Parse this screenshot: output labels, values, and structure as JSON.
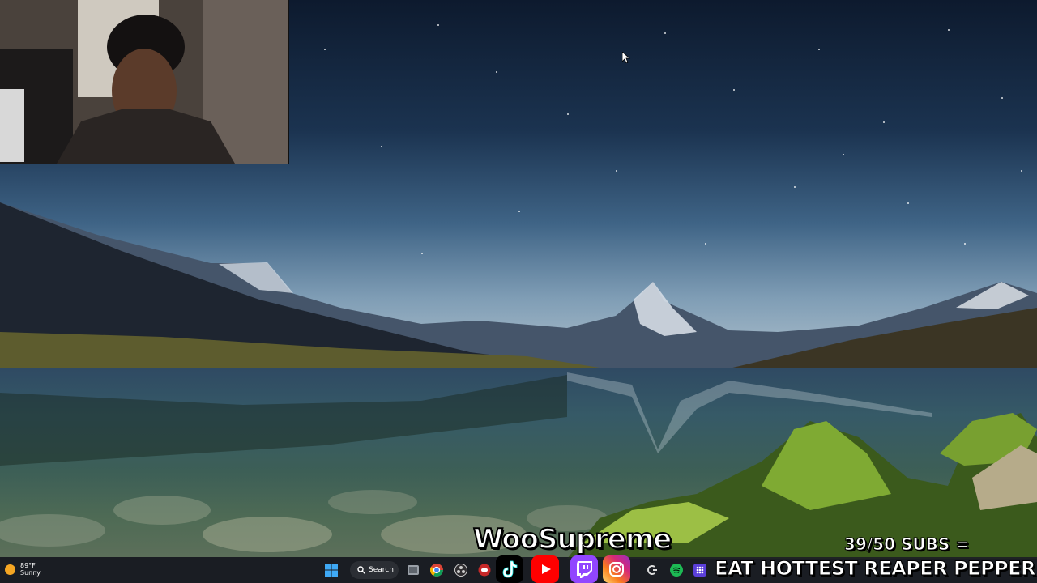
{
  "overlay": {
    "channel_name": "WooSupreme",
    "sub_goal": "39/50 SUBS =",
    "challenge": "EAT HOTTEST REAPER PEPPER"
  },
  "taskbar": {
    "weather": {
      "temp": "89°F",
      "condition": "Sunny"
    },
    "search_label": "Search",
    "icons": [
      "windows-start-icon",
      "search-icon",
      "task-view-icon",
      "chrome-icon",
      "obs-icon",
      "app-icon",
      "app-icon",
      "app-icon",
      "spotify-icon",
      "app-grid-icon"
    ]
  },
  "social_icons": [
    "tiktok-icon",
    "youtube-icon",
    "twitch-icon",
    "instagram-icon"
  ],
  "colors": {
    "youtube": "#ff0000",
    "twitch": "#9146ff",
    "instagram": "#e1306c",
    "spotify": "#1db954",
    "weather_sun": "#f5a623"
  }
}
